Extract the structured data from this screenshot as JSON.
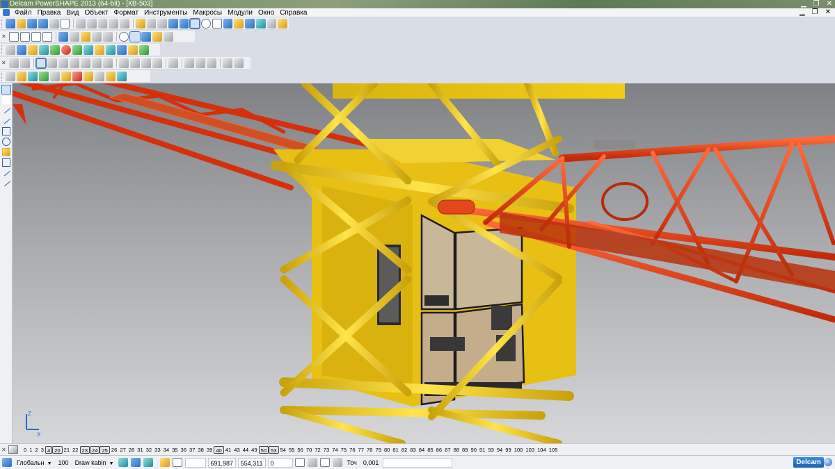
{
  "window": {
    "title": "Delcam PowerSHAPE 2013 (64-bit) - [КВ-503]"
  },
  "menu": {
    "items": [
      "Файл",
      "Правка",
      "Вид",
      "Объект",
      "Формат",
      "Инструменты",
      "Макросы",
      "Модули",
      "Окно",
      "Справка"
    ]
  },
  "toolbars": {
    "row1_icons": [
      "new-file-icon",
      "open-icon",
      "save-icon",
      "save-all-icon",
      "print-icon",
      "wizard-icon",
      "cut-icon",
      "copy-icon",
      "paste-icon",
      "pen-icon",
      "delete-icon",
      "undo-icon",
      "redo-icon",
      "repeat-icon",
      "select-icon",
      "filter-icon",
      "arrow-select-icon",
      "circle-select-icon",
      "lasso-icon",
      "text-icon",
      "gear-icon",
      "layer-icon",
      "stack-icon",
      "wand-icon",
      "tools-icon"
    ],
    "row2_icons": [
      "view-top-icon",
      "view-front-icon",
      "view-side-icon",
      "view-iso-icon",
      "view-fit-icon",
      "zoom-in-icon",
      "zoom-out-icon",
      "zoom-window-icon",
      "zoom-dynamic-icon",
      "rotate-icon",
      "shade-icon",
      "wireframe-icon",
      "lights-icon",
      "material-icon"
    ],
    "row3_icons": [
      "model-icon",
      "table-icon",
      "layer-icon",
      "surface-icon",
      "solid-icon",
      "color-ball-icon",
      "play-icon",
      "forward-icon",
      "box-icon",
      "calc-icon",
      "measure-icon",
      "analysis-icon",
      "arrow-icon"
    ],
    "row4_icons": [
      "curve-icon",
      "arc-icon",
      "spline-icon",
      "composite-icon",
      "wireframe-box-icon",
      "sweep-icon",
      "extrude-icon",
      "revolve-icon",
      "fillet-icon",
      "chamfer-icon",
      "offset-icon",
      "trim-icon",
      "blend-icon",
      "loft-icon",
      "drive-icon",
      "shell-icon",
      "mesh-icon",
      "convert-icon",
      "split-icon"
    ],
    "row5_icons": [
      "point-icon",
      "axis-icon",
      "workplane-icon",
      "sphere-icon",
      "cylinder-icon",
      "cone-icon",
      "torus-icon",
      "box-solid-icon",
      "grid-icon",
      "group-icon",
      "wedge-icon"
    ]
  },
  "left_toolbar": {
    "icons": [
      "select-arrow-icon",
      "grid-select-icon",
      "line-icon",
      "polyline-icon",
      "rectangle-icon",
      "circle-icon",
      "box-icon",
      "dimension-icon",
      "arc-icon",
      "curve-icon"
    ]
  },
  "viewport": {
    "axis_labels": [
      "Z",
      "X"
    ]
  },
  "levels": {
    "items": [
      {
        "label": "0",
        "boxed": false
      },
      {
        "label": "1",
        "boxed": false
      },
      {
        "label": "2",
        "boxed": false
      },
      {
        "label": "3",
        "boxed": false
      },
      {
        "label": "4",
        "boxed": true
      },
      {
        "label": "20",
        "boxed": true
      },
      {
        "label": "21",
        "boxed": false
      },
      {
        "label": "22",
        "boxed": false
      },
      {
        "label": "23",
        "boxed": true
      },
      {
        "label": "24",
        "boxed": true
      },
      {
        "label": "25",
        "boxed": true
      },
      {
        "label": "26",
        "boxed": false
      },
      {
        "label": "27",
        "boxed": false
      },
      {
        "label": "28",
        "boxed": false
      },
      {
        "label": "31",
        "boxed": false
      },
      {
        "label": "32",
        "boxed": false
      },
      {
        "label": "33",
        "boxed": false
      },
      {
        "label": "34",
        "boxed": false
      },
      {
        "label": "35",
        "boxed": false
      },
      {
        "label": "36",
        "boxed": false
      },
      {
        "label": "37",
        "boxed": false
      },
      {
        "label": "38",
        "boxed": false
      },
      {
        "label": "39",
        "boxed": false
      },
      {
        "label": "40",
        "boxed": true
      },
      {
        "label": "41",
        "boxed": false
      },
      {
        "label": "43",
        "boxed": false
      },
      {
        "label": "44",
        "boxed": false
      },
      {
        "label": "49",
        "boxed": false
      },
      {
        "label": "50",
        "boxed": true
      },
      {
        "label": "53",
        "boxed": true
      },
      {
        "label": "54",
        "boxed": false
      },
      {
        "label": "55",
        "boxed": false
      },
      {
        "label": "56",
        "boxed": false
      },
      {
        "label": "70",
        "boxed": false
      },
      {
        "label": "72",
        "boxed": false
      },
      {
        "label": "73",
        "boxed": false
      },
      {
        "label": "74",
        "boxed": false
      },
      {
        "label": "75",
        "boxed": false
      },
      {
        "label": "76",
        "boxed": false
      },
      {
        "label": "77",
        "boxed": false
      },
      {
        "label": "78",
        "boxed": false
      },
      {
        "label": "79",
        "boxed": false
      },
      {
        "label": "80",
        "boxed": false
      },
      {
        "label": "81",
        "boxed": false
      },
      {
        "label": "82",
        "boxed": false
      },
      {
        "label": "83",
        "boxed": false
      },
      {
        "label": "84",
        "boxed": false
      },
      {
        "label": "85",
        "boxed": false
      },
      {
        "label": "86",
        "boxed": false
      },
      {
        "label": "87",
        "boxed": false
      },
      {
        "label": "88",
        "boxed": false
      },
      {
        "label": "89",
        "boxed": false
      },
      {
        "label": "90",
        "boxed": false
      },
      {
        "label": "91",
        "boxed": false
      },
      {
        "label": "93",
        "boxed": false
      },
      {
        "label": "94",
        "boxed": false
      },
      {
        "label": "99",
        "boxed": false
      },
      {
        "label": "100",
        "boxed": false
      },
      {
        "label": "103",
        "boxed": false
      },
      {
        "label": "104",
        "boxed": false
      },
      {
        "label": "105",
        "boxed": false
      }
    ]
  },
  "status": {
    "workplane": "Глобальн",
    "number": "100",
    "object_name": "Draw kabin",
    "coord_x": "691,987",
    "coord_y": "554,311",
    "coord_z": "0",
    "tolerance_label": "Точ",
    "tolerance_value": "0,001",
    "brand": "Delcam"
  },
  "colors": {
    "mast_yellow": "#f5d21c",
    "jib_red": "#e23a12",
    "cabin_glass": "#c9b79a"
  }
}
